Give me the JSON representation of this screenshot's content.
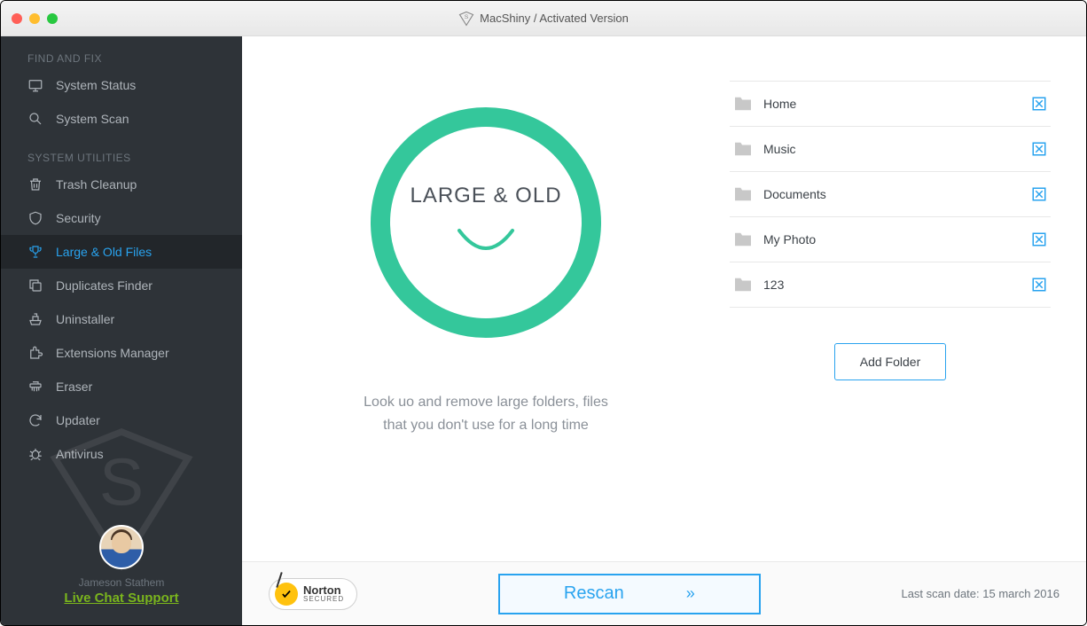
{
  "titlebar": {
    "app_name": "MacShiny",
    "status": "Activated Version"
  },
  "sidebar": {
    "section1_label": "FIND AND FIX",
    "section2_label": "SYSTEM UTILITIES",
    "items_find": [
      {
        "label": "System Status",
        "icon": "monitor"
      },
      {
        "label": "System Scan",
        "icon": "search"
      }
    ],
    "items_util": [
      {
        "label": "Trash Cleanup",
        "icon": "trash"
      },
      {
        "label": "Security",
        "icon": "shield"
      },
      {
        "label": "Large & Old Files",
        "icon": "cup",
        "active": true
      },
      {
        "label": "Duplicates Finder",
        "icon": "copy"
      },
      {
        "label": "Uninstaller",
        "icon": "brush"
      },
      {
        "label": "Extensions Manager",
        "icon": "puzzle"
      },
      {
        "label": "Eraser",
        "icon": "shredder"
      },
      {
        "label": "Updater",
        "icon": "refresh"
      },
      {
        "label": "Antivirus",
        "icon": "bug"
      }
    ],
    "user_name": "Jameson Stathem",
    "chat_label": "Live Chat Support"
  },
  "main": {
    "circle_title": "LARGE & OLD",
    "description_line1": "Look uo and remove large folders, files",
    "description_line2": "that you don't use for a long time",
    "folders": [
      {
        "name": "Home"
      },
      {
        "name": "Music"
      },
      {
        "name": "Documents"
      },
      {
        "name": "My Photo"
      },
      {
        "name": "123"
      }
    ],
    "add_folder_label": "Add Folder"
  },
  "bottom": {
    "norton_brand": "Norton",
    "norton_secured": "SECURED",
    "rescan_label": "Rescan",
    "last_scan_prefix": "Last scan date: ",
    "last_scan_date": "15 march 2016"
  }
}
